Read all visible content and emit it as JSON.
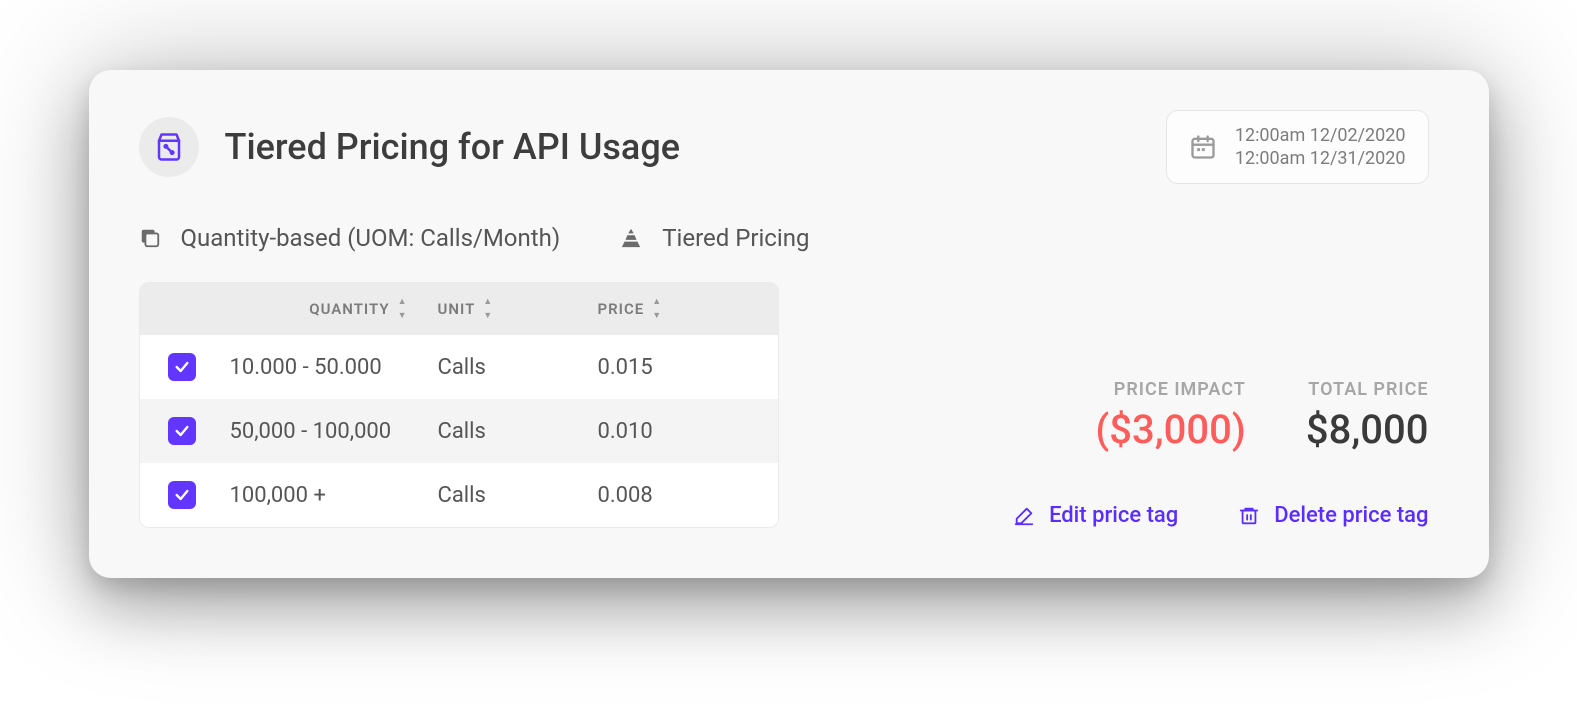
{
  "header": {
    "title": "Tiered Pricing for API Usage",
    "date_start": "12:00am 12/02/2020",
    "date_end": "12:00am 12/31/2020"
  },
  "meta": {
    "pricing_model": "Quantity-based (UOM: Calls/Month)",
    "pricing_type": "Tiered Pricing"
  },
  "table": {
    "columns": {
      "quantity": "QUANTITY",
      "unit": "UNIT",
      "price": "PRICE"
    },
    "rows": [
      {
        "quantity": "10.000 - 50.000",
        "unit": "Calls",
        "price": "0.015"
      },
      {
        "quantity": "50,000 - 100,000",
        "unit": "Calls",
        "price": "0.010"
      },
      {
        "quantity": "100,000 +",
        "unit": "Calls",
        "price": "0.008"
      }
    ]
  },
  "summary": {
    "impact_label": "PRICE IMPACT",
    "impact_value": "($3,000)",
    "total_label": "TOTAL PRICE",
    "total_value": "$8,000"
  },
  "actions": {
    "edit": "Edit price tag",
    "delete": "Delete price tag"
  },
  "colors": {
    "primary": "#6336ff",
    "danger": "#ff5c5c"
  }
}
